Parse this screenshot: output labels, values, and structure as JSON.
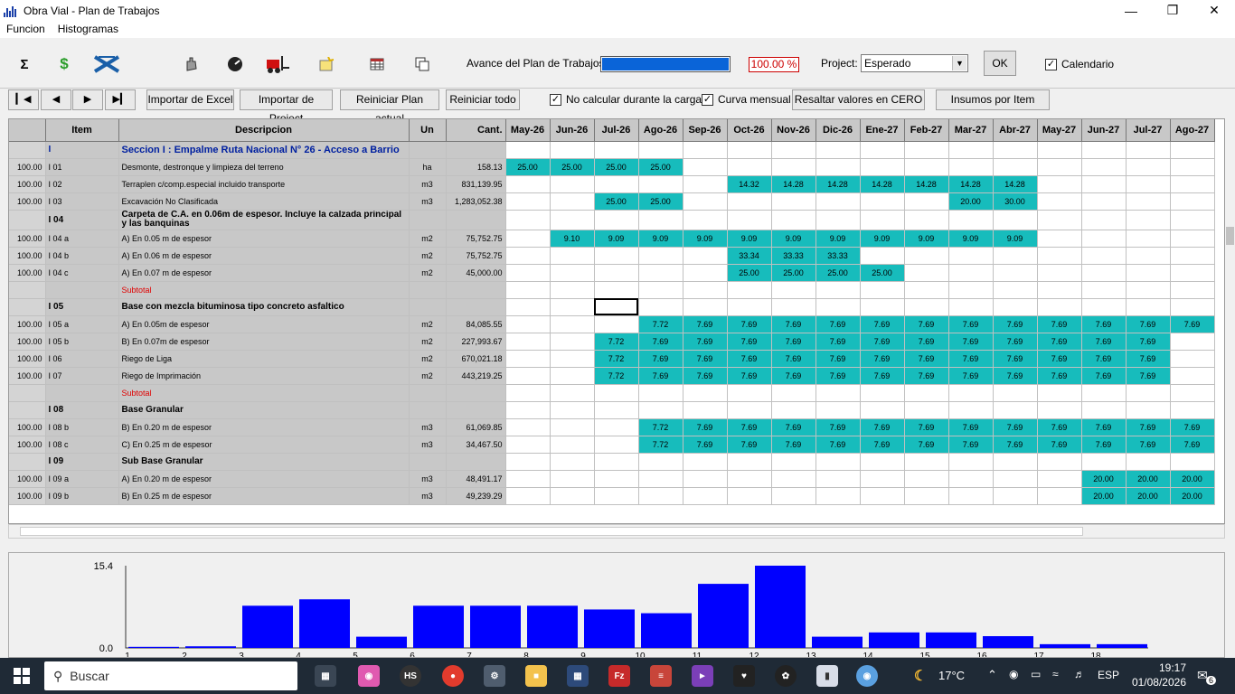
{
  "window": {
    "title": "Obra Vial - Plan de Trabajos"
  },
  "menu": [
    "Funcion",
    "Histogramas"
  ],
  "toolbar": {
    "avance_label": "Avance del Plan de Trabajos",
    "avance_pct": "100.00 %",
    "avance_fraction": 1.0,
    "project_label": "Project:",
    "project_value": "Esperado",
    "ok_label": "OK",
    "calendario_label": "Calendario"
  },
  "toolbar2": {
    "importar_excel": "Importar de Excel",
    "importar_project": "Importar de Project",
    "reiniciar_actual": "Reiniciar Plan actual",
    "reiniciar_todo": "Reiniciar todo",
    "no_calcular": "No calcular durante la carga",
    "curva_mensual": "Curva mensual",
    "resaltar": "Resaltar valores en CERO",
    "insumos": "Insumos por Item"
  },
  "grid": {
    "headers": [
      "Item",
      "Descripcion",
      "Un",
      "Cant."
    ],
    "months": [
      "May-26",
      "Jun-26",
      "Jul-26",
      "Ago-26",
      "Sep-26",
      "Oct-26",
      "Nov-26",
      "Dic-26",
      "Ene-27",
      "Feb-27",
      "Mar-27",
      "Abr-27",
      "May-27",
      "Jun-27",
      "Jul-27",
      "Ago-27"
    ],
    "rows": [
      {
        "pct": "",
        "item": "I",
        "desc": "Seccion I : Empalme Ruta Nacional N° 26 - Acceso a Barrio",
        "un": "",
        "cant": "",
        "type": "sec",
        "cells": [
          "",
          "",
          "",
          "",
          "",
          "",
          "",
          "",
          "",
          "",
          "",
          "",
          "",
          "",
          "",
          ""
        ]
      },
      {
        "pct": "100.00",
        "item": "I 01",
        "desc": "Desmonte, destronque y limpieza del terreno",
        "un": "ha",
        "cant": "158.13",
        "type": "item",
        "cells": [
          "25.00",
          "25.00",
          "25.00",
          "25.00",
          "",
          "",
          "",
          "",
          "",
          "",
          "",
          "",
          "",
          "",
          "",
          ""
        ]
      },
      {
        "pct": "100.00",
        "item": "I 02",
        "desc": "Terraplen c/comp.especial incluido transporte",
        "un": "m3",
        "cant": "831,139.95",
        "type": "item",
        "cells": [
          "",
          "",
          "",
          "",
          "",
          "14.32",
          "14.28",
          "14.28",
          "14.28",
          "14.28",
          "14.28",
          "14.28",
          "",
          "",
          "",
          ""
        ]
      },
      {
        "pct": "100.00",
        "item": "I 03",
        "desc": "Excavación No Clasificada",
        "un": "m3",
        "cant": "1,283,052.38",
        "type": "item",
        "cells": [
          "",
          "",
          "25.00",
          "25.00",
          "",
          "",
          "",
          "",
          "",
          "",
          "20.00",
          "30.00",
          "",
          "",
          "",
          ""
        ]
      },
      {
        "pct": "",
        "item": "I 04",
        "desc": "Carpeta de C.A. en 0.06m de espesor. Incluye la calzada principal y las banquinas",
        "un": "",
        "cant": "",
        "type": "hdr2",
        "cells": [
          "",
          "",
          "",
          "",
          "",
          "",
          "",
          "",
          "",
          "",
          "",
          "",
          "",
          "",
          "",
          ""
        ]
      },
      {
        "pct": "100.00",
        "item": "I 04 a",
        "desc": "A) En 0.05 m de espesor",
        "un": "m2",
        "cant": "75,752.75",
        "type": "item",
        "cells": [
          "",
          "9.10",
          "9.09",
          "9.09",
          "9.09",
          "9.09",
          "9.09",
          "9.09",
          "9.09",
          "9.09",
          "9.09",
          "9.09",
          "",
          "",
          "",
          ""
        ]
      },
      {
        "pct": "100.00",
        "item": "I 04 b",
        "desc": "A) En 0.06 m de espesor",
        "un": "m2",
        "cant": "75,752.75",
        "type": "item",
        "cells": [
          "",
          "",
          "",
          "",
          "",
          "33.34",
          "33.33",
          "33.33",
          "",
          "",
          "",
          "",
          "",
          "",
          "",
          ""
        ]
      },
      {
        "pct": "100.00",
        "item": "I 04 c",
        "desc": "A) En 0.07 m de espesor",
        "un": "m2",
        "cant": "45,000.00",
        "type": "item",
        "cells": [
          "",
          "",
          "",
          "",
          "",
          "25.00",
          "25.00",
          "25.00",
          "25.00",
          "",
          "",
          "",
          "",
          "",
          "",
          ""
        ]
      },
      {
        "pct": "",
        "item": "",
        "desc": "Subtotal",
        "un": "",
        "cant": "",
        "type": "sub",
        "cells": [
          "",
          "",
          "",
          "",
          "",
          "",
          "",
          "",
          "",
          "",
          "",
          "",
          "",
          "",
          "",
          ""
        ]
      },
      {
        "pct": "",
        "item": "I 05",
        "desc": "Base con mezcla bituminosa tipo concreto asfaltico",
        "un": "",
        "cant": "",
        "type": "hdr",
        "cells": [
          "",
          "",
          "",
          "",
          "",
          "",
          "",
          "",
          "",
          "",
          "",
          "",
          "",
          "",
          "",
          ""
        ]
      },
      {
        "pct": "100.00",
        "item": "I 05 a",
        "desc": "A) En 0.05m de espesor",
        "un": "m2",
        "cant": "84,085.55",
        "type": "item",
        "cells": [
          "",
          "",
          "",
          "7.72",
          "7.69",
          "7.69",
          "7.69",
          "7.69",
          "7.69",
          "7.69",
          "7.69",
          "7.69",
          "7.69",
          "7.69",
          "7.69",
          "7.69"
        ]
      },
      {
        "pct": "100.00",
        "item": "I 05 b",
        "desc": "B) En 0.07m de espesor",
        "un": "m2",
        "cant": "227,993.67",
        "type": "item",
        "cells": [
          "",
          "",
          "7.72",
          "7.69",
          "7.69",
          "7.69",
          "7.69",
          "7.69",
          "7.69",
          "7.69",
          "7.69",
          "7.69",
          "7.69",
          "7.69",
          "7.69",
          ""
        ]
      },
      {
        "pct": "100.00",
        "item": "I 06",
        "desc": "Riego de Liga",
        "un": "m2",
        "cant": "670,021.18",
        "type": "item",
        "cells": [
          "",
          "",
          "7.72",
          "7.69",
          "7.69",
          "7.69",
          "7.69",
          "7.69",
          "7.69",
          "7.69",
          "7.69",
          "7.69",
          "7.69",
          "7.69",
          "7.69",
          ""
        ]
      },
      {
        "pct": "100.00",
        "item": "I 07",
        "desc": "Riego de Imprimación",
        "un": "m2",
        "cant": "443,219.25",
        "type": "item",
        "cells": [
          "",
          "",
          "7.72",
          "7.69",
          "7.69",
          "7.69",
          "7.69",
          "7.69",
          "7.69",
          "7.69",
          "7.69",
          "7.69",
          "7.69",
          "7.69",
          "7.69",
          ""
        ]
      },
      {
        "pct": "",
        "item": "",
        "desc": "Subtotal",
        "un": "",
        "cant": "",
        "type": "sub",
        "cells": [
          "",
          "",
          "",
          "",
          "",
          "",
          "",
          "",
          "",
          "",
          "",
          "",
          "",
          "",
          "",
          ""
        ]
      },
      {
        "pct": "",
        "item": "I 08",
        "desc": "Base Granular",
        "un": "",
        "cant": "",
        "type": "hdr",
        "cells": [
          "",
          "",
          "",
          "",
          "",
          "",
          "",
          "",
          "",
          "",
          "",
          "",
          "",
          "",
          "",
          ""
        ]
      },
      {
        "pct": "100.00",
        "item": "I 08 b",
        "desc": "B) En 0.20 m de espesor",
        "un": "m3",
        "cant": "61,069.85",
        "type": "item",
        "cells": [
          "",
          "",
          "",
          "7.72",
          "7.69",
          "7.69",
          "7.69",
          "7.69",
          "7.69",
          "7.69",
          "7.69",
          "7.69",
          "7.69",
          "7.69",
          "7.69",
          "7.69"
        ]
      },
      {
        "pct": "100.00",
        "item": "I 08 c",
        "desc": "C) En 0.25 m de espesor",
        "un": "m3",
        "cant": "34,467.50",
        "type": "item",
        "cells": [
          "",
          "",
          "",
          "7.72",
          "7.69",
          "7.69",
          "7.69",
          "7.69",
          "7.69",
          "7.69",
          "7.69",
          "7.69",
          "7.69",
          "7.69",
          "7.69",
          "7.69"
        ]
      },
      {
        "pct": "",
        "item": "I 09",
        "desc": "Sub Base Granular",
        "un": "",
        "cant": "",
        "type": "hdr",
        "cells": [
          "",
          "",
          "",
          "",
          "",
          "",
          "",
          "",
          "",
          "",
          "",
          "",
          "",
          "",
          "",
          ""
        ]
      },
      {
        "pct": "100.00",
        "item": "I 09 a",
        "desc": "A) En 0.20 m de espesor",
        "un": "m3",
        "cant": "48,491.17",
        "type": "item",
        "cells": [
          "",
          "",
          "",
          "",
          "",
          "",
          "",
          "",
          "",
          "",
          "",
          "",
          "",
          "20.00",
          "20.00",
          "20.00"
        ]
      },
      {
        "pct": "100.00",
        "item": "I 09 b",
        "desc": "B) En 0.25 m de espesor",
        "un": "m3",
        "cant": "49,239.29",
        "type": "item",
        "cells": [
          "",
          "",
          "",
          "",
          "",
          "",
          "",
          "",
          "",
          "",
          "",
          "",
          "",
          "20.00",
          "20.00",
          "20.00"
        ]
      }
    ]
  },
  "chart_data": {
    "type": "bar",
    "categories": [
      "1",
      "2",
      "3",
      "4",
      "5",
      "6",
      "7",
      "8",
      "9",
      "10",
      "11",
      "12",
      "13",
      "14",
      "15",
      "16",
      "17",
      "18"
    ],
    "values": [
      0.2,
      0.3,
      7.9,
      9.1,
      2.1,
      7.9,
      7.9,
      7.9,
      7.2,
      6.5,
      12.0,
      15.4,
      2.1,
      2.9,
      2.9,
      2.2,
      0.7,
      0.7
    ],
    "ylim": [
      0.0,
      15.4
    ],
    "yticks": [
      "15.4",
      "0.0"
    ],
    "color": "#0000ff"
  },
  "taskbar": {
    "search": "Buscar",
    "temp": "17°C",
    "lang": "ESP",
    "time": "19:17",
    "date": "01/08/2026",
    "notif": "6"
  }
}
